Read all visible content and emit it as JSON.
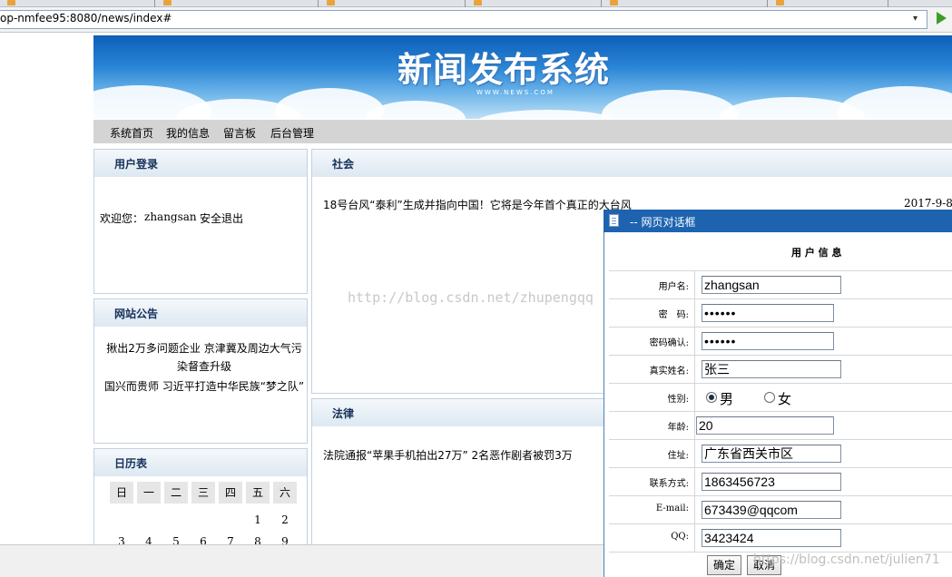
{
  "browser": {
    "url": "op-nmfee95:8080/news/index#",
    "dropdown_glyph": "▾"
  },
  "banner": {
    "title": "新闻发布系统",
    "subtitle": "WWW.NEWS.COM"
  },
  "nav": {
    "items": [
      "系统首页",
      "我的信息",
      "留言板",
      "后台管理"
    ]
  },
  "login": {
    "title": "用户登录",
    "welcome_prefix": "欢迎您：",
    "username": "zhangsan",
    "logout": "安全退出"
  },
  "notice": {
    "title": "网站公告",
    "items": [
      "揪出2万多问题企业 京津冀及周边大气污染督查升级",
      "国兴而贵师 习近平打造中华民族“梦之队”"
    ]
  },
  "calendar": {
    "title": "日历表",
    "weekdays": [
      "日",
      "一",
      "二",
      "三",
      "四",
      "五",
      "六"
    ],
    "rows": [
      [
        "",
        "",
        "",
        "",
        "",
        "1",
        "2"
      ],
      [
        "3",
        "4",
        "5",
        "6",
        "7",
        "8",
        "9"
      ]
    ]
  },
  "society": {
    "title": "社会",
    "headline": "18号台风“泰利”生成并指向中国！它将是今年首个真正的大台风",
    "date": "2017-9-8"
  },
  "law": {
    "title": "法律",
    "headline": "法院通报“苹果手机拍出27万” 2名恶作剧者被罚3万"
  },
  "watermark": "http://blog.csdn.net/zhupengqq",
  "watermark_bottom": "https://blog.csdn.net/julien71",
  "dialog": {
    "title": "-- 网页对话框",
    "heading": "用 户 信 息",
    "fields": {
      "username": {
        "label": "用户名:",
        "value": "zhangsan"
      },
      "password": {
        "label": "密　码:",
        "value": "••••••"
      },
      "password_confirm": {
        "label": "密码确认:",
        "value": "••••••"
      },
      "realname": {
        "label": "真实姓名:",
        "value": "张三"
      },
      "gender": {
        "label": "性别:",
        "options": [
          "男",
          "女"
        ],
        "selected": "男"
      },
      "age": {
        "label": "年龄:",
        "value": "20"
      },
      "address": {
        "label": "住址:",
        "value": "广东省西关市区"
      },
      "phone": {
        "label": "联系方式:",
        "value": "1863456723"
      },
      "email": {
        "label": "E-mail:",
        "value": "673439@qqcom"
      },
      "qq": {
        "label": "QQ:",
        "value": "3423424"
      }
    },
    "buttons": {
      "ok": "确定",
      "cancel": "取消"
    }
  }
}
